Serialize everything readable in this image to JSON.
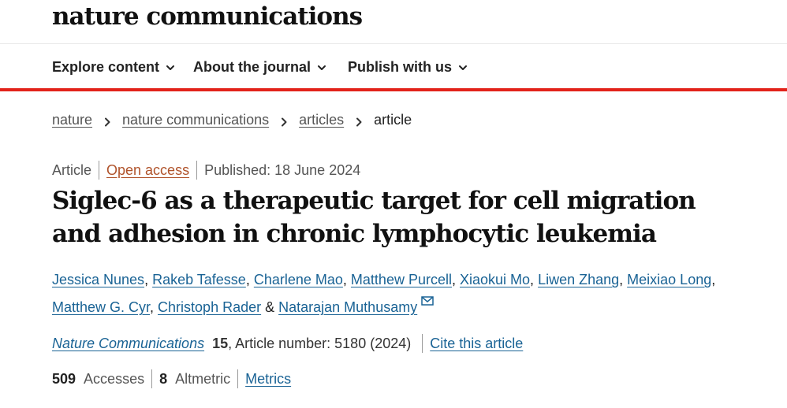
{
  "brand": {
    "logo_text": "nature communications"
  },
  "nav": {
    "items": [
      {
        "label": "Explore content"
      },
      {
        "label": "About the journal"
      },
      {
        "label": "Publish with us"
      }
    ]
  },
  "breadcrumb": {
    "items": [
      "nature",
      "nature communications",
      "articles"
    ],
    "current": "article"
  },
  "article_meta": {
    "type": "Article",
    "access": "Open access",
    "published": "Published: 18 June 2024"
  },
  "title": "Siglec-6 as a therapeutic target for cell migration and adhesion in chronic lymphocytic leukemia",
  "authors": [
    "Jessica Nunes",
    "Rakeb Tafesse",
    "Charlene Mao",
    "Matthew Purcell",
    "Xiaokui Mo",
    "Liwen Zhang",
    "Meixiao Long",
    "Matthew G. Cyr",
    "Christoph Rader",
    "Natarajan Muthusamy"
  ],
  "author_separators": {
    "comma": ", ",
    "ampersand": " & "
  },
  "citation": {
    "journal": "Nature Communications",
    "volume": "15",
    "article_number": ", Article number: 5180 (2024)",
    "cite_label": "Cite this article"
  },
  "metrics": {
    "accesses_value": "509",
    "accesses_label": "Accesses",
    "altmetric_value": "8",
    "altmetric_label": "Altmetric",
    "metrics_link": "Metrics"
  },
  "colors": {
    "accent_red": "#e2231a",
    "link_blue": "#1a6395",
    "open_access_orange": "#b0532b"
  },
  "icons": {
    "nav_chevron": "chevron-down-icon",
    "breadcrumb_separator": "chevron-right-icon",
    "corresponding_author": "mail-icon"
  }
}
